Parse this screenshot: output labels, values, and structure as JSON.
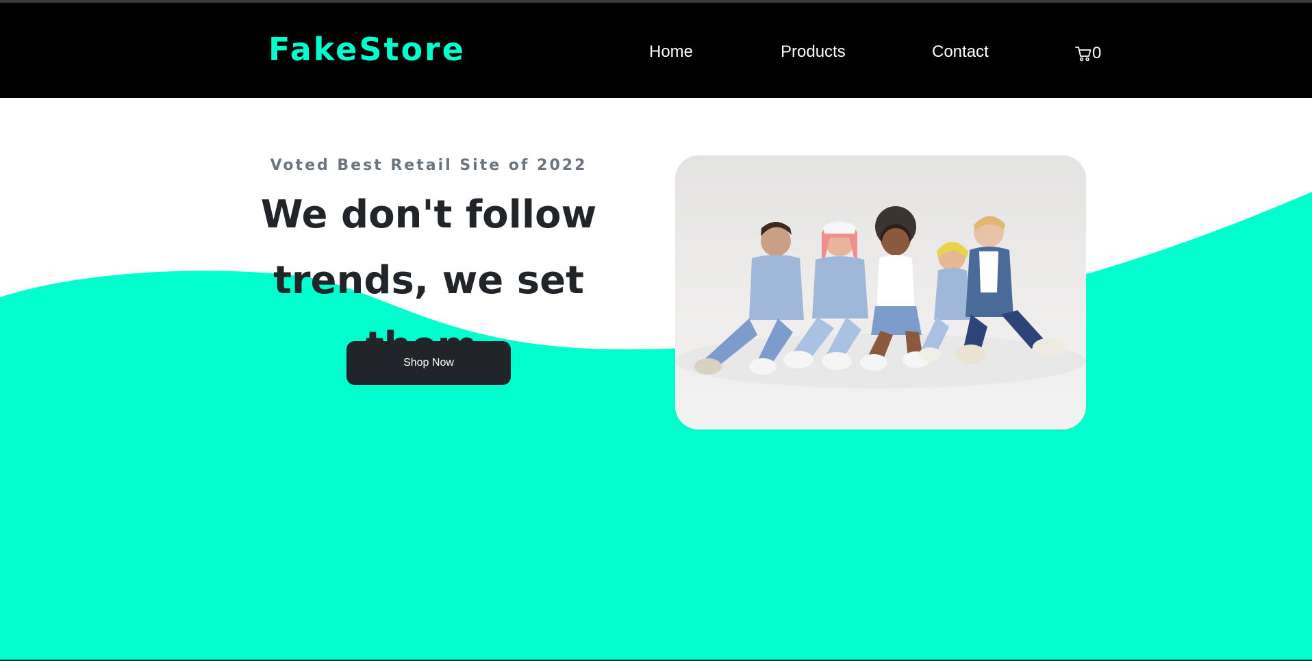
{
  "brand": {
    "name": "FakeStore",
    "color": "#00ffcc"
  },
  "nav": {
    "items": [
      {
        "label": "Home"
      },
      {
        "label": "Products"
      },
      {
        "label": "Contact"
      }
    ],
    "cart_count": "0",
    "cart_icon": "cart-icon"
  },
  "hero": {
    "tagline": "Voted Best Retail Site of 2022",
    "headline_line1": "We don't follow",
    "headline_line2": "trends, we set them.",
    "cta_label": "Shop Now",
    "image_icon": "group-photo",
    "accent_color": "#00ffcc",
    "button_color": "#212529"
  }
}
